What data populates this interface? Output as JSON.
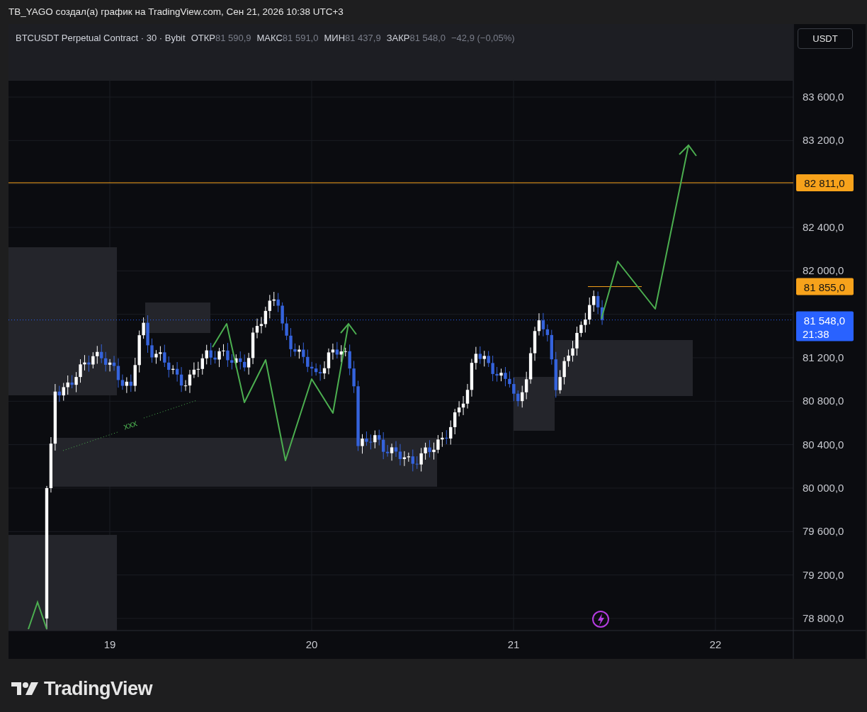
{
  "caption": "TB_YAGO создал(а) график на TradingView.com, Сен 21, 2026 10:38 UTC+3",
  "legend": {
    "symbol": "BTCUSDT Perpetual Contract · 30 · Bybit",
    "fields": [
      {
        "label": "ОТКР",
        "value": "81 590,9"
      },
      {
        "label": "МАКС",
        "value": "81 591,0"
      },
      {
        "label": "МИН",
        "value": "81 437,9"
      },
      {
        "label": "ЗАКР",
        "value": "81 548,0"
      }
    ],
    "change": "−42,9 (−0,05%)"
  },
  "currency_button": "USDT",
  "price_axis": {
    "ticks": [
      "83 600,0",
      "83 200,0",
      "82 400,0",
      "82 000,0",
      "81 200,0",
      "80 800,0",
      "80 400,0",
      "80 000,0",
      "79 600,0",
      "79 200,0",
      "78 800,0"
    ],
    "markers": [
      {
        "kind": "level",
        "price": "82 811,0",
        "color": "#f7a21b"
      },
      {
        "kind": "level",
        "price": "81 855,0",
        "color": "#f7a21b"
      },
      {
        "kind": "last",
        "price": "81 548,0",
        "countdown": "21:38",
        "color": "#2962ff"
      }
    ]
  },
  "time_axis": {
    "ticks": [
      "19",
      "20",
      "21",
      "22"
    ]
  },
  "annotation": "xxx",
  "brand": "TradingView"
}
